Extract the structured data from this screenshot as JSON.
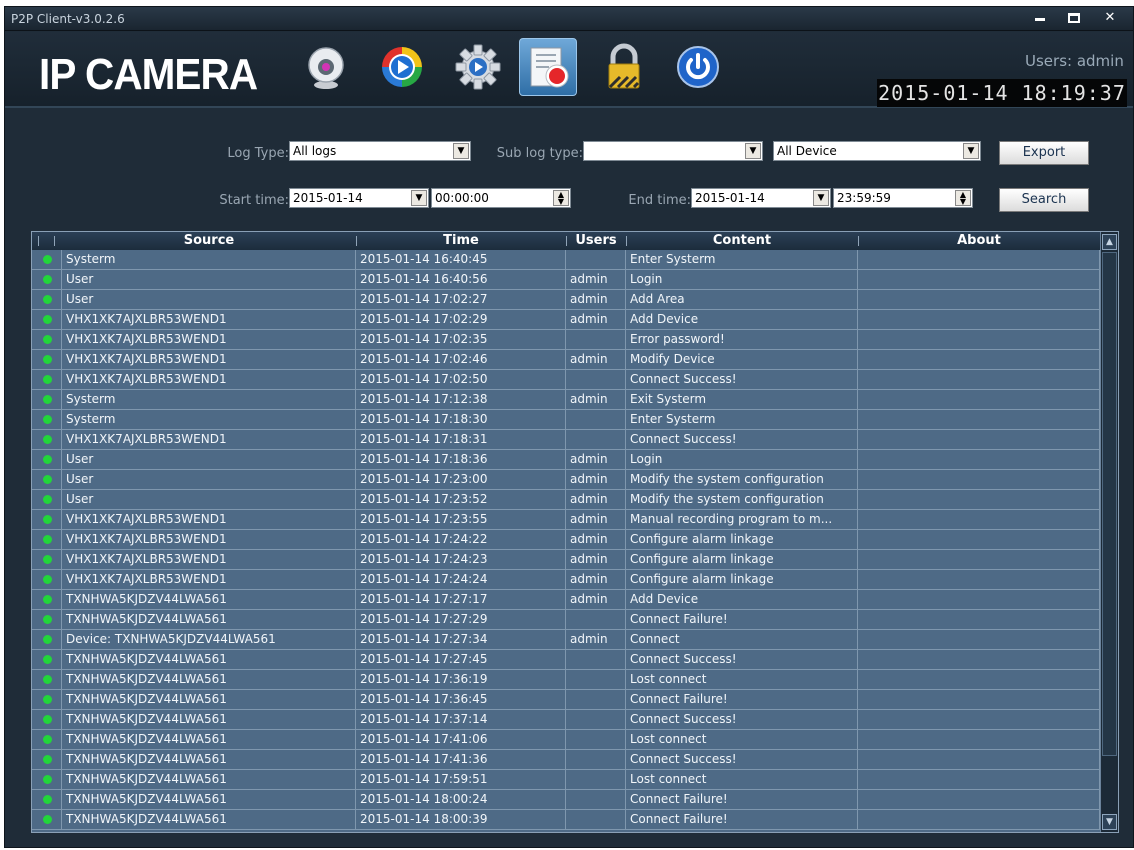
{
  "window": {
    "title": "P2P Client-v3.0.2.6"
  },
  "header": {
    "logo": "IP CAMERA",
    "users_label": "Users: admin",
    "clock": "2015-01-14 18:19:37",
    "toolbar": [
      {
        "icon": "webcam-icon"
      },
      {
        "icon": "playback-icon"
      },
      {
        "icon": "settings-gear-icon"
      },
      {
        "icon": "log-record-icon",
        "active": true
      },
      {
        "icon": "lock-icon"
      },
      {
        "icon": "power-icon"
      }
    ]
  },
  "filters": {
    "log_type_label": "Log Type:",
    "log_type_value": "All logs",
    "sub_log_type_label": "Sub log type:",
    "sub_log_type_value": "",
    "device_value": "All Device",
    "export_label": "Export",
    "start_time_label": "Start time:",
    "start_date": "2015-01-14",
    "start_clock": "00:00:00",
    "end_time_label": "End time:",
    "end_date": "2015-01-14",
    "end_clock": "23:59:59",
    "search_label": "Search"
  },
  "table": {
    "headers": [
      "Source",
      "Time",
      "Users",
      "Content",
      "About"
    ],
    "rows": [
      [
        "Systerm",
        "2015-01-14 16:40:45",
        "",
        "Enter Systerm",
        ""
      ],
      [
        "User",
        "2015-01-14 16:40:56",
        "admin",
        "Login",
        ""
      ],
      [
        "User",
        "2015-01-14 17:02:27",
        "admin",
        "Add Area",
        ""
      ],
      [
        "VHX1XK7AJXLBR53WEND1",
        "2015-01-14 17:02:29",
        "admin",
        "Add Device",
        ""
      ],
      [
        "VHX1XK7AJXLBR53WEND1",
        "2015-01-14 17:02:35",
        "",
        "Error password!",
        ""
      ],
      [
        "VHX1XK7AJXLBR53WEND1",
        "2015-01-14 17:02:46",
        "admin",
        "Modify Device",
        ""
      ],
      [
        "VHX1XK7AJXLBR53WEND1",
        "2015-01-14 17:02:50",
        "",
        "Connect Success!",
        ""
      ],
      [
        "Systerm",
        "2015-01-14 17:12:38",
        "admin",
        "Exit Systerm",
        ""
      ],
      [
        "Systerm",
        "2015-01-14 17:18:30",
        "",
        "Enter Systerm",
        ""
      ],
      [
        "VHX1XK7AJXLBR53WEND1",
        "2015-01-14 17:18:31",
        "",
        "Connect Success!",
        ""
      ],
      [
        "User",
        "2015-01-14 17:18:36",
        "admin",
        "Login",
        ""
      ],
      [
        "User",
        "2015-01-14 17:23:00",
        "admin",
        "Modify the system configuration",
        ""
      ],
      [
        "User",
        "2015-01-14 17:23:52",
        "admin",
        "Modify the system configuration",
        ""
      ],
      [
        "VHX1XK7AJXLBR53WEND1",
        "2015-01-14 17:23:55",
        "admin",
        "Manual recording program to m...",
        ""
      ],
      [
        "VHX1XK7AJXLBR53WEND1",
        "2015-01-14 17:24:22",
        "admin",
        "Configure alarm linkage",
        ""
      ],
      [
        "VHX1XK7AJXLBR53WEND1",
        "2015-01-14 17:24:23",
        "admin",
        "Configure alarm linkage",
        ""
      ],
      [
        "VHX1XK7AJXLBR53WEND1",
        "2015-01-14 17:24:24",
        "admin",
        "Configure alarm linkage",
        ""
      ],
      [
        "TXNHWA5KJDZV44LWA561",
        "2015-01-14 17:27:17",
        "admin",
        "Add Device",
        ""
      ],
      [
        "TXNHWA5KJDZV44LWA561",
        "2015-01-14 17:27:29",
        "",
        "Connect Failure!",
        ""
      ],
      [
        "Device: TXNHWA5KJDZV44LWA561",
        "2015-01-14 17:27:34",
        "admin",
        "Connect",
        ""
      ],
      [
        "TXNHWA5KJDZV44LWA561",
        "2015-01-14 17:27:45",
        "",
        "Connect Success!",
        ""
      ],
      [
        "TXNHWA5KJDZV44LWA561",
        "2015-01-14 17:36:19",
        "",
        "Lost connect",
        ""
      ],
      [
        "TXNHWA5KJDZV44LWA561",
        "2015-01-14 17:36:45",
        "",
        "Connect Failure!",
        ""
      ],
      [
        "TXNHWA5KJDZV44LWA561",
        "2015-01-14 17:37:14",
        "",
        "Connect Success!",
        ""
      ],
      [
        "TXNHWA5KJDZV44LWA561",
        "2015-01-14 17:41:06",
        "",
        "Lost connect",
        ""
      ],
      [
        "TXNHWA5KJDZV44LWA561",
        "2015-01-14 17:41:36",
        "",
        "Connect Success!",
        ""
      ],
      [
        "TXNHWA5KJDZV44LWA561",
        "2015-01-14 17:59:51",
        "",
        "Lost connect",
        ""
      ],
      [
        "TXNHWA5KJDZV44LWA561",
        "2015-01-14 18:00:24",
        "",
        "Connect Failure!",
        ""
      ],
      [
        "TXNHWA5KJDZV44LWA561",
        "2015-01-14 18:00:39",
        "",
        "Connect Failure!",
        ""
      ]
    ]
  },
  "colors": {
    "status_dot": "#22d63a",
    "table_bg": "#4e6a86",
    "window_bg": "#1f2c38"
  }
}
